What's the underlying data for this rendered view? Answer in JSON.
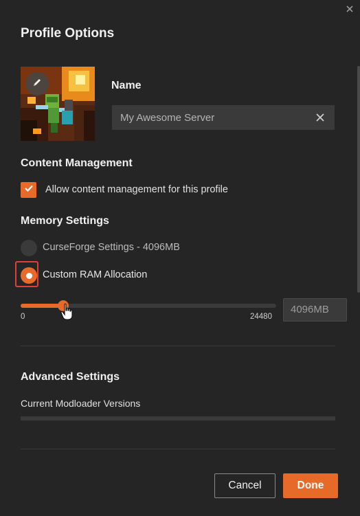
{
  "dialog": {
    "title": "Profile Options"
  },
  "profile": {
    "name_label": "Name",
    "name_value": "My Awesome Server"
  },
  "content_management": {
    "title": "Content Management",
    "allow_label": "Allow content management for this profile",
    "allow_checked": true
  },
  "memory": {
    "title": "Memory Settings",
    "option_default_label": "CurseForge Settings - 4096MB",
    "option_custom_label": "Custom RAM Allocation",
    "selected": "custom",
    "slider_min": "0",
    "slider_max": "24480",
    "slider_value": 4096,
    "slider_max_value": 24480,
    "ram_value": "4096MB"
  },
  "advanced": {
    "title": "Advanced Settings",
    "versions_label": "Current Modloader Versions"
  },
  "footer": {
    "cancel_label": "Cancel",
    "done_label": "Done"
  },
  "colors": {
    "accent": "#e76a29",
    "background": "#252526",
    "field": "#3a3a3a",
    "focus_ring": "#e0403a"
  },
  "icons": {
    "close": "close-icon",
    "clear": "clear-icon",
    "edit": "pencil-icon",
    "check": "check-icon",
    "cursor": "hand-cursor-icon"
  }
}
